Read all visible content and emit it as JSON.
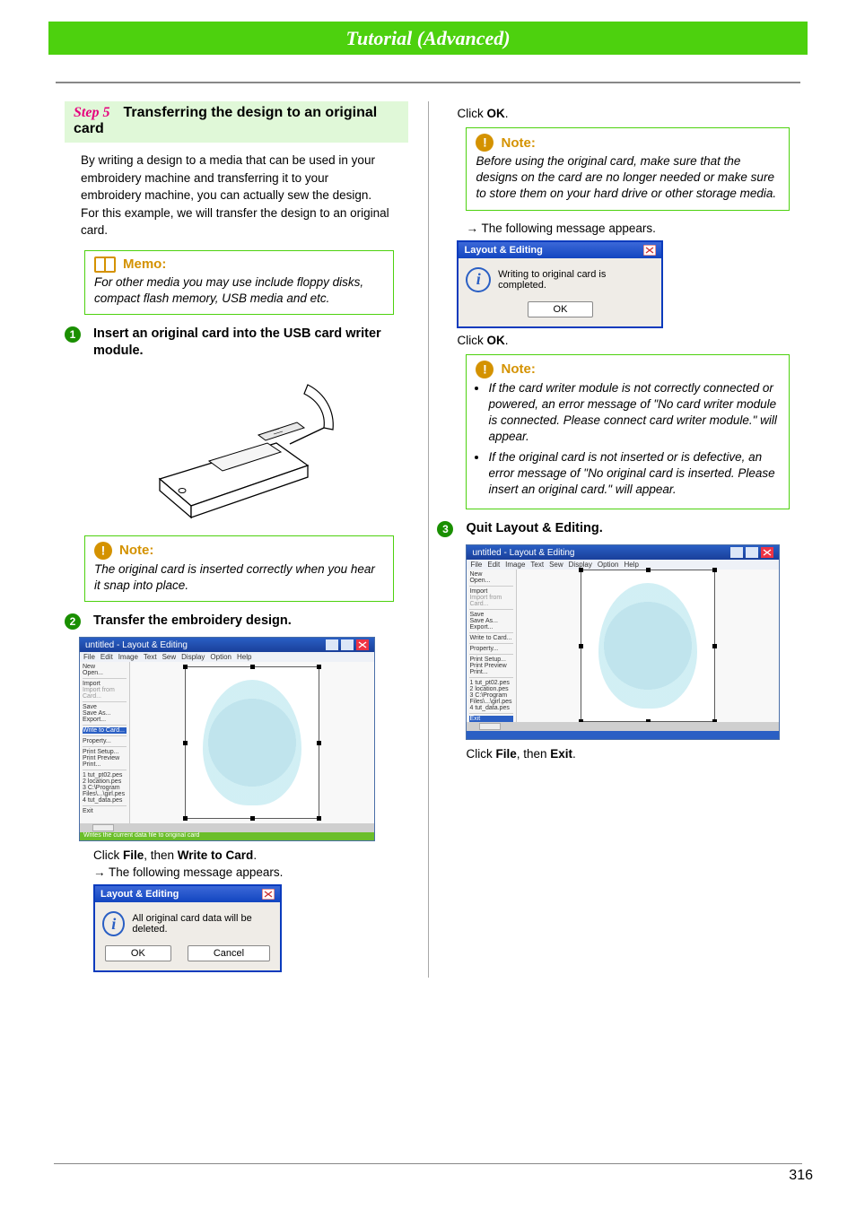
{
  "header": {
    "title": "Tutorial (Advanced)"
  },
  "step": {
    "label": "Step 5",
    "title": "Transferring the design to an original card"
  },
  "intro": "By writing a design to a media that can be used in your embroidery machine and transferring it to your embroidery machine, you can actually sew the design. For this example, we will transfer the design to an original card.",
  "memo": {
    "label": "Memo:",
    "body": "For other media you may use include floppy disks, compact flash memory, USB media and etc."
  },
  "steps": {
    "n1": {
      "num": "1",
      "text": "Insert an original card into the USB card writer module."
    },
    "n2": {
      "num": "2",
      "text": "Transfer the embroidery design."
    },
    "n3": {
      "num": "3",
      "text": "Quit Layout & Editing."
    }
  },
  "note_snap": {
    "label": "Note:",
    "body": "The original card is inserted correctly when you hear it snap into place."
  },
  "click_write": {
    "pre": "Click ",
    "a": "File",
    "mid": ", then ",
    "b": "Write to Card",
    "post": "."
  },
  "arrow_after_write": "→ The following message appears.",
  "dialog_delete": {
    "title": "Layout & Editing",
    "msg": "All original card data will be deleted.",
    "ok": "OK",
    "cancel": "Cancel"
  },
  "click_ok1": {
    "pre": "Click ",
    "a": "OK",
    "post": "."
  },
  "note_before": {
    "label": "Note:",
    "body": "Before using the original card, make sure that the designs on the card are no longer needed or make sure to store them on your hard drive or other storage media."
  },
  "arrow_after_ok": "→ The following message appears.",
  "dialog_complete": {
    "title": "Layout & Editing",
    "msg": "Writing to original card is completed.",
    "ok": "OK"
  },
  "click_ok2": {
    "pre": "Click ",
    "a": "OK",
    "post": "."
  },
  "note_errors": {
    "label": "Note:",
    "items": [
      "If the card writer module is not correctly connected or powered, an error message of \"No card writer module is connected. Please connect card writer module.\" will appear.",
      "If the original card is not inserted or is defective, an error message of \"No original card is inserted. Please insert an original card.\" will appear."
    ]
  },
  "click_exit": {
    "pre": "Click ",
    "a": "File",
    "mid": ", then ",
    "b": "Exit",
    "post": "."
  },
  "app_window": {
    "title": "untitled - Layout & Editing",
    "menus": [
      "File",
      "Edit",
      "Image",
      "Text",
      "Sew",
      "Display",
      "Option",
      "Help"
    ],
    "file_menu": [
      "New",
      "Open...",
      "Import",
      "Import from Card...",
      "Save",
      "Save As...",
      "Export...",
      "Write to Card...",
      "Property...",
      "Print Setup...",
      "Print Preview",
      "Print...",
      "1 tut_pt02.pes",
      "2 location.pes",
      "3 C:\\Program Files\\...\\girl.pes",
      "4 tut_data.pes",
      "Exit"
    ],
    "status": "Writes the current data file to original card"
  },
  "dialog_info_icon": "i",
  "page_number": "316"
}
